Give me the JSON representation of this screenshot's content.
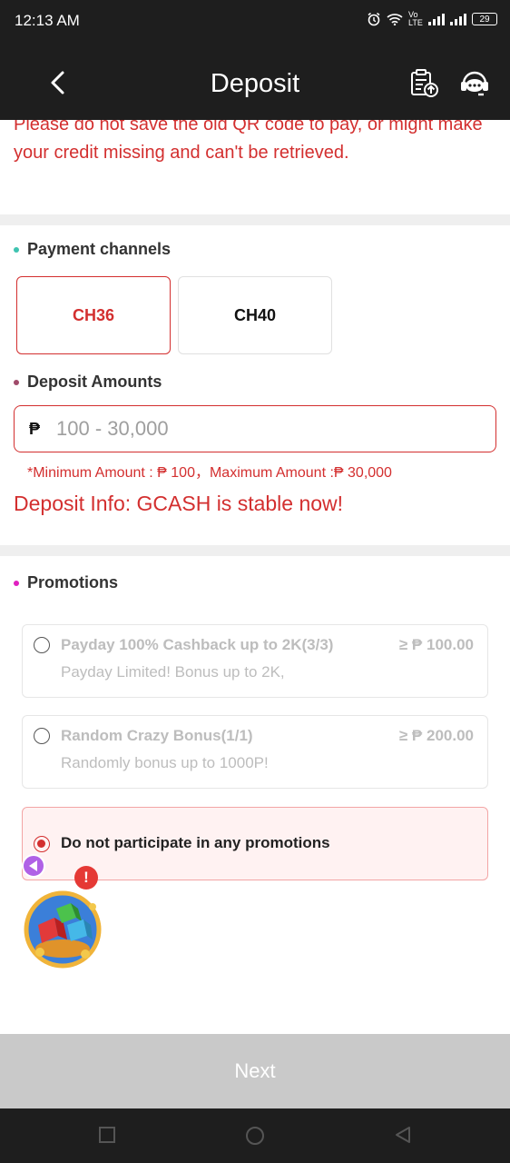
{
  "status_bar": {
    "time": "12:13 AM",
    "network": "Vo LTE",
    "battery": "29"
  },
  "header": {
    "title": "Deposit"
  },
  "notice": {
    "text": "Please do not save the old QR code to pay, or might make your credit missing and can't be retrieved."
  },
  "payment_channels": {
    "title": "Payment channels",
    "dot_color": "#3ec3b0",
    "channels": [
      {
        "label": "CH36",
        "selected": true
      },
      {
        "label": "CH40",
        "selected": false
      }
    ]
  },
  "deposit_amounts": {
    "title": "Deposit Amounts",
    "dot_color": "#a04a6a",
    "currency_symbol": "₱",
    "placeholder": "100 - 30,000",
    "value": "",
    "limits_text": "*Minimum Amount : ₱ 100，Maximum Amount :₱ 30,000",
    "info_text": "Deposit Info: GCASH is stable now!"
  },
  "promotions": {
    "title": "Promotions",
    "dot_color": "#e020c0",
    "items": [
      {
        "name": "Payday 100% Cashback up to 2K(3/3)",
        "amount": "≥ ₱ 100.00",
        "desc": "Payday Limited! Bonus up to 2K,",
        "selected": false
      },
      {
        "name": "Random Crazy Bonus(1/1)",
        "amount": "≥ ₱ 200.00",
        "desc": "Randomly bonus up to 1000P!",
        "selected": false
      }
    ],
    "none_option": {
      "name": "Do not participate in any promotions",
      "selected": true
    }
  },
  "floating_widget": {
    "badge": "!"
  },
  "next_button": {
    "label": "Next"
  },
  "colors": {
    "accent": "#d32f2f",
    "header_bg": "#1e1e1e",
    "disabled_button": "#c9c9c9"
  }
}
